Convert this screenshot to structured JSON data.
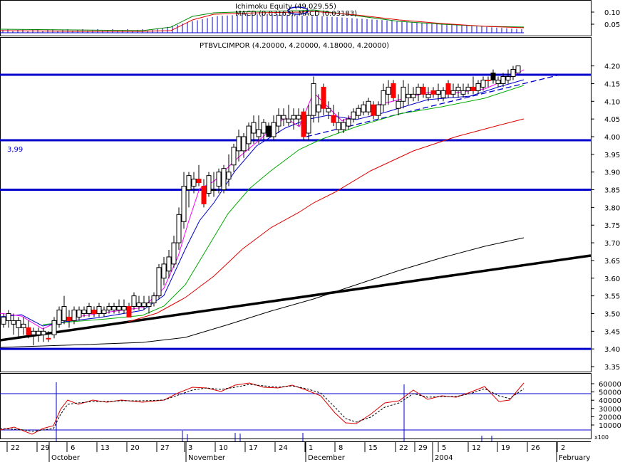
{
  "chart_data": {
    "type": "candlestick",
    "title": "PTBVLCIMPOR (4.20000, 4.20000, 4.18000, 4.20000)",
    "macd_label": "MACD (0.03163), MACD (0.03183)",
    "overlay_label": "Ichimoku Equity (49.029.55)",
    "price_level_label": "3,99",
    "axis_right": {
      "price_ticks": [
        "4.20",
        "4.15",
        "4.10",
        "4.05",
        "4.00",
        "3.95",
        "3.90",
        "3.85",
        "3.80",
        "3.75",
        "3.70",
        "3.65",
        "3.60",
        "3.55",
        "3.50",
        "3.45",
        "3.40",
        "3.35"
      ],
      "macd_ticks": [
        "0.10",
        "0.05"
      ],
      "osc_ticks": [
        "60000",
        "50000",
        "40000",
        "30000",
        "20000",
        "10000"
      ],
      "osc_unit": "x100"
    },
    "x_axis": {
      "day_ticks": [
        "22",
        "29",
        "6",
        "13",
        "20",
        "27",
        "3",
        "10",
        "17",
        "24",
        "1",
        "8",
        "15",
        "22",
        "29",
        "5",
        "12",
        "19",
        "26",
        "2"
      ],
      "month_labels": [
        "October",
        "November",
        "December",
        "2004",
        "February"
      ]
    },
    "horizontal_levels": [
      4.175,
      3.99,
      3.85,
      3.4
    ],
    "ylim": [
      3.33,
      4.23
    ],
    "colors": {
      "level_line": "#0000cc",
      "ma_fast": "#ff00ff",
      "ma_blue": "#0000cc",
      "ma_green": "#00aa00",
      "ma_red": "#dd0000",
      "ma_black": "#000000",
      "down_candle": "#ff0000",
      "up_candle": "#ffffff"
    }
  }
}
